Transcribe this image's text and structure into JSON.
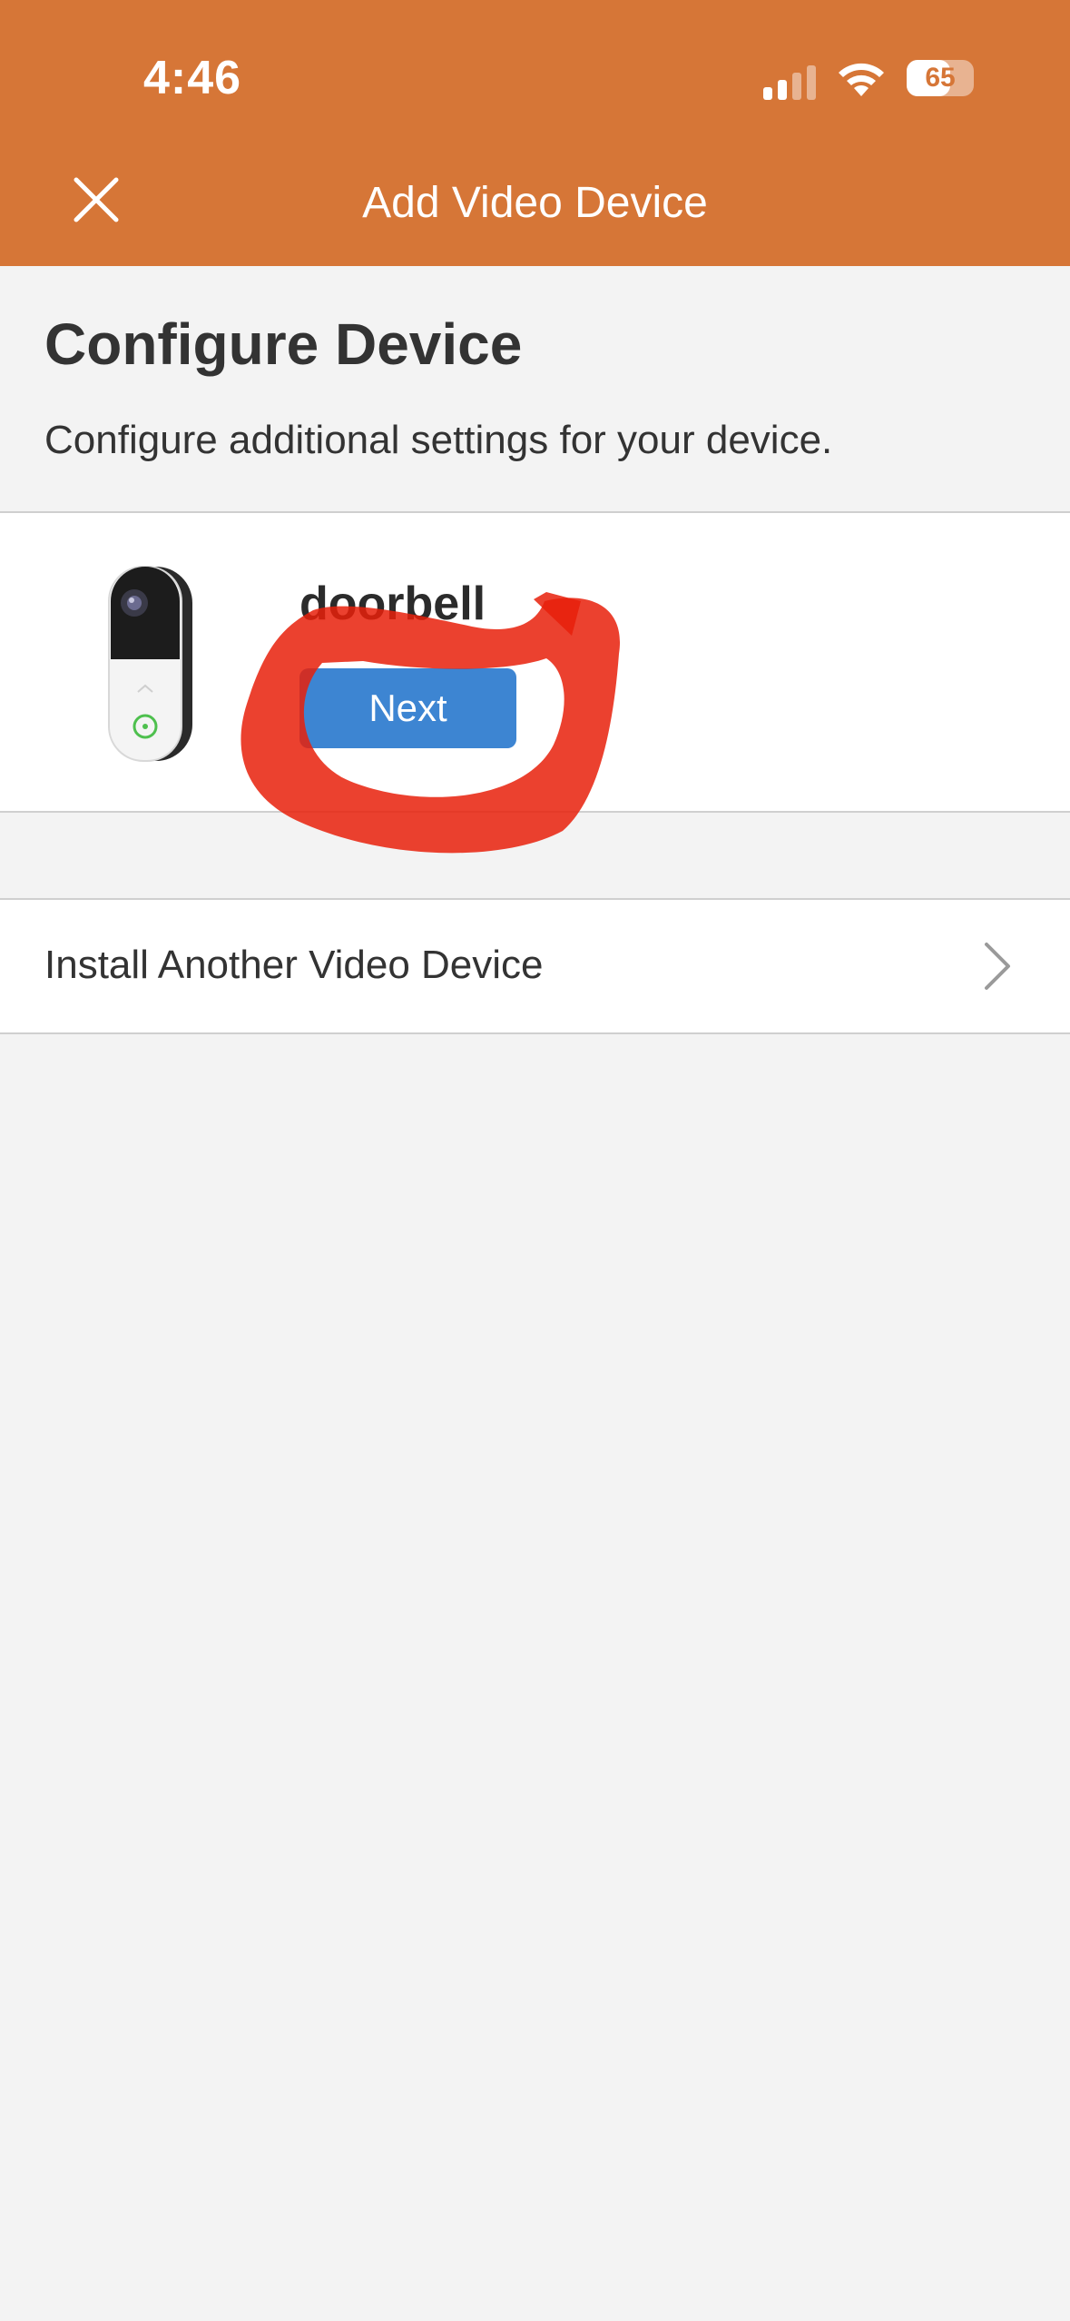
{
  "status_bar": {
    "time": "4:46",
    "battery_level": "65",
    "battery_fraction": 0.65,
    "signal_icon": "cellular-signal-icon",
    "wifi_icon": "wifi-icon",
    "battery_icon": "battery-icon"
  },
  "nav": {
    "title": "Add Video Device",
    "close_icon": "close-icon"
  },
  "page": {
    "title": "Configure Device",
    "subtitle": "Configure additional settings for your device."
  },
  "device": {
    "name": "doorbell",
    "next_label": "Next",
    "image_icon": "doorbell-camera-icon"
  },
  "install_another": {
    "label": "Install Another Video Device",
    "chevron_icon": "chevron-right-icon"
  },
  "colors": {
    "header": "#d67637",
    "button": "#3d85d2",
    "background": "#f3f3f3",
    "annotation": "#e8200a"
  }
}
